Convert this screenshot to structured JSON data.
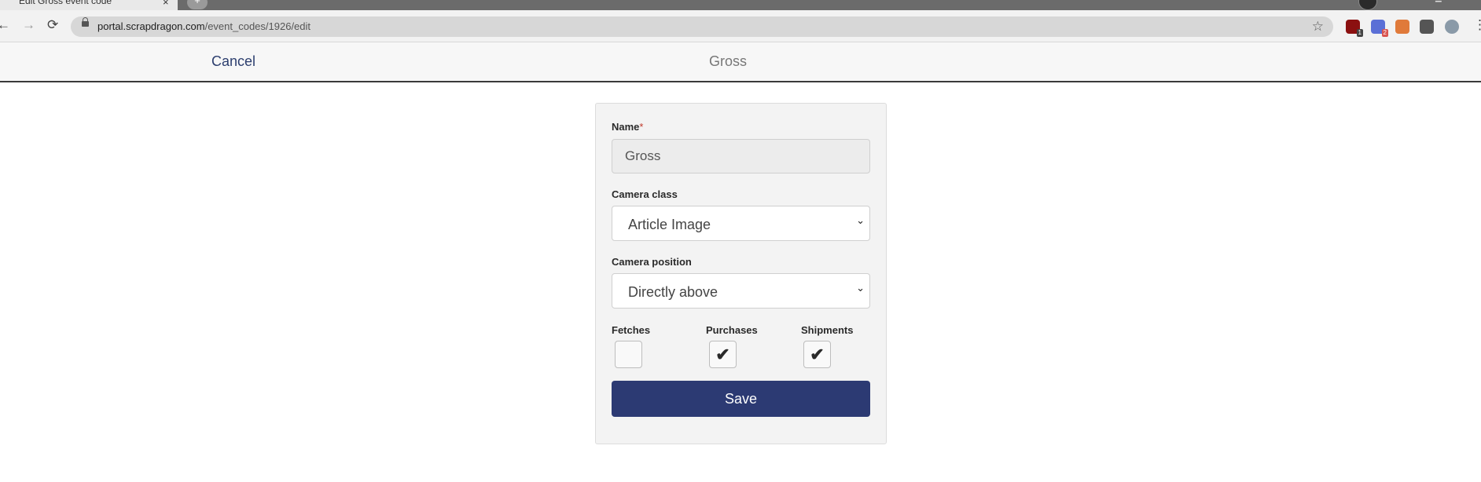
{
  "browser": {
    "tab_title": "Edit Gross event code",
    "tab_close": "×",
    "new_tab": "+",
    "url_host": "portal.scrapdragon.com",
    "url_path": "/event_codes/1926/edit",
    "back_icon": "←",
    "forward_icon": "→",
    "reload_icon": "⟳",
    "star_icon": "☆",
    "menu_icon": "⋮",
    "extensions": [
      {
        "name": "ublock-icon",
        "color": "#8b1010",
        "badge": "1",
        "badge_color": "#444444"
      },
      {
        "name": "gear-extension-icon",
        "color": "#5b6fd6",
        "badge": "2",
        "badge_color": "#d9534f"
      },
      {
        "name": "capsule-extension-icon",
        "color": "#e07a3a",
        "badge": "",
        "badge_color": ""
      },
      {
        "name": "puzzle-icon",
        "color": "#555555",
        "badge": "",
        "badge_color": ""
      },
      {
        "name": "avatar",
        "color": "#8a9aa8",
        "badge": "",
        "badge_color": ""
      }
    ]
  },
  "header": {
    "cancel_label": "Cancel",
    "title": "Gross"
  },
  "form": {
    "name_label": "Name",
    "required_marker": "*",
    "name_value": "Gross",
    "camera_class_label": "Camera class",
    "camera_class_value": "Article Image",
    "camera_position_label": "Camera position",
    "camera_position_value": "Directly above",
    "checkboxes": [
      {
        "label": "Fetches",
        "checked": false
      },
      {
        "label": "Purchases",
        "checked": true
      },
      {
        "label": "Shipments",
        "checked": true
      }
    ],
    "tick_glyph": "✔",
    "chevron_glyph": "⌄",
    "save_label": "Save"
  },
  "colors": {
    "primary": "#2c3a73",
    "link": "#2c3e6e"
  }
}
